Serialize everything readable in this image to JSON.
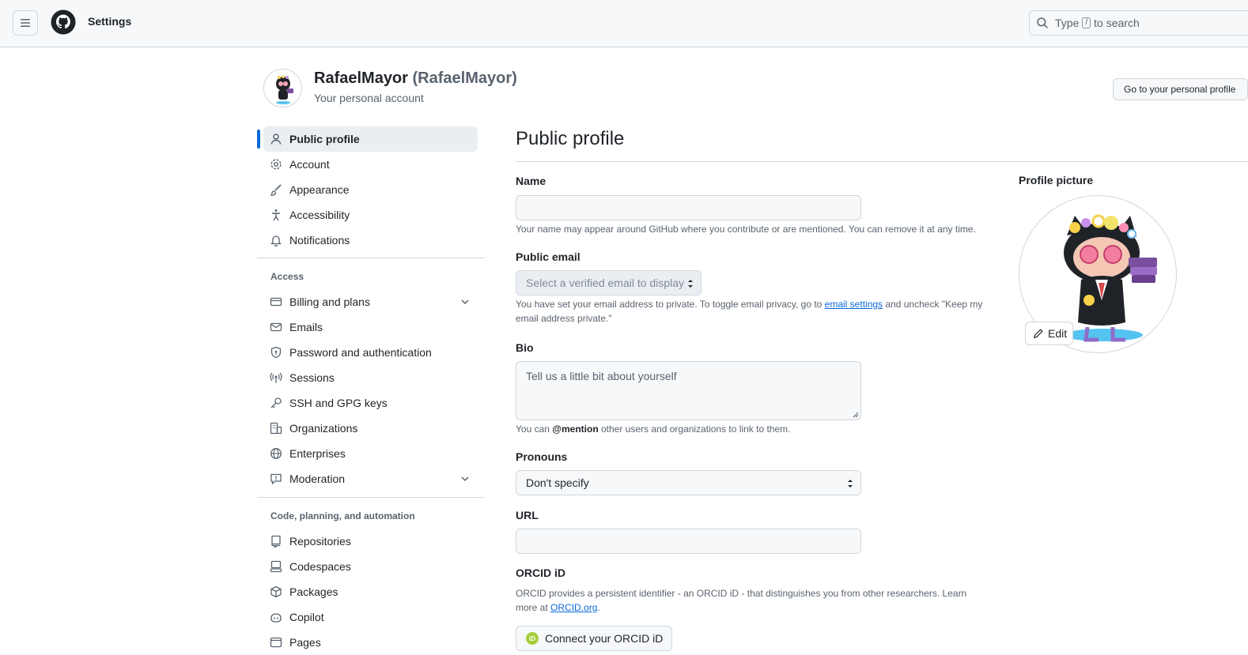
{
  "header": {
    "title": "Settings",
    "search": {
      "prefix": "Type",
      "key": "/",
      "suffix": "to search"
    }
  },
  "account": {
    "display_name": "RafaelMayor",
    "login": "(RafaelMayor)",
    "subtitle": "Your personal account",
    "profile_button": "Go to your personal profile"
  },
  "sidebar": {
    "top_items": [
      {
        "label": "Public profile",
        "icon": "person-icon",
        "active": true
      },
      {
        "label": "Account",
        "icon": "gear-icon"
      },
      {
        "label": "Appearance",
        "icon": "paintbrush-icon"
      },
      {
        "label": "Accessibility",
        "icon": "accessibility-icon"
      },
      {
        "label": "Notifications",
        "icon": "bell-icon"
      }
    ],
    "access_heading": "Access",
    "access_items": [
      {
        "label": "Billing and plans",
        "icon": "credit-card-icon",
        "expandable": true
      },
      {
        "label": "Emails",
        "icon": "mail-icon"
      },
      {
        "label": "Password and authentication",
        "icon": "shield-lock-icon"
      },
      {
        "label": "Sessions",
        "icon": "broadcast-icon"
      },
      {
        "label": "SSH and GPG keys",
        "icon": "key-icon"
      },
      {
        "label": "Organizations",
        "icon": "organization-icon"
      },
      {
        "label": "Enterprises",
        "icon": "globe-icon"
      },
      {
        "label": "Moderation",
        "icon": "report-icon",
        "expandable": true
      }
    ],
    "code_heading": "Code, planning, and automation",
    "code_items": [
      {
        "label": "Repositories",
        "icon": "repo-icon"
      },
      {
        "label": "Codespaces",
        "icon": "codespaces-icon"
      },
      {
        "label": "Packages",
        "icon": "package-icon"
      },
      {
        "label": "Copilot",
        "icon": "copilot-icon"
      },
      {
        "label": "Pages",
        "icon": "browser-icon"
      }
    ]
  },
  "main": {
    "title": "Public profile",
    "name": {
      "label": "Name",
      "value": "",
      "note": "Your name may appear around GitHub where you contribute or are mentioned. You can remove it at any time."
    },
    "public_email": {
      "label": "Public email",
      "placeholder": "Select a verified email to display",
      "note_before": "You have set your email address to private. To toggle email privacy, go to",
      "note_link": "email settings",
      "note_after": "and uncheck \"Keep my email address private.\""
    },
    "bio": {
      "label": "Bio",
      "placeholder": "Tell us a little bit about yourself",
      "note_before": "You can",
      "note_mention": "@mention",
      "note_after": "other users and organizations to link to them."
    },
    "pronouns": {
      "label": "Pronouns",
      "value": "Don't specify"
    },
    "url": {
      "label": "URL",
      "value": ""
    },
    "orcid": {
      "label": "ORCID iD",
      "note_before": "ORCID provides a persistent identifier - an ORCID iD - that distinguishes you from other researchers. Learn more at",
      "note_link": "ORCID.org",
      "note_after": ".",
      "button": "Connect your ORCID iD",
      "badge": "iD"
    }
  },
  "profile_picture": {
    "label": "Profile picture",
    "edit_label": "Edit"
  },
  "colors": {
    "accent": "#0969da",
    "border": "#d0d7de",
    "header_bg": "#f6f8fa"
  }
}
